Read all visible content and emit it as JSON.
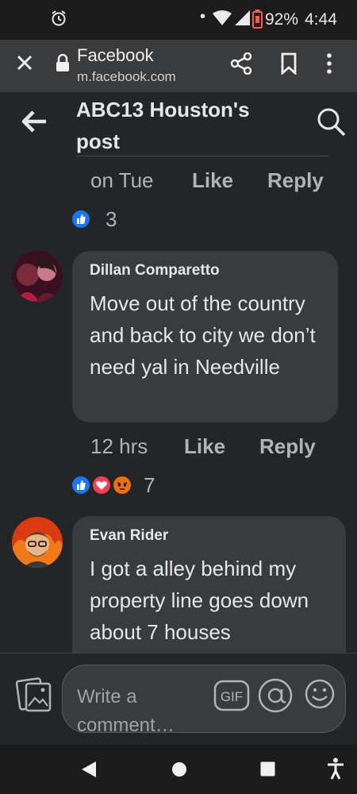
{
  "status_bar": {
    "battery": "92%",
    "time": "4:44"
  },
  "browser": {
    "title": "Facebook",
    "url": "m.facebook.com"
  },
  "header": {
    "title": "ABC13 Houston's post"
  },
  "prev_comment": {
    "time": "on Tue",
    "like_label": "Like",
    "reply_label": "Reply",
    "reaction_count": "3"
  },
  "comments": [
    {
      "author": "Dillan Comparetto",
      "text": "Move out of the country and back to city we don’t need yal in Needville",
      "time": "12 hrs",
      "like_label": "Like",
      "reply_label": "Reply",
      "reaction_count": "7"
    },
    {
      "author": "Evan Rider",
      "text": "I got a alley behind my property line  goes down about 7 houses"
    }
  ],
  "composer": {
    "placeholder": "Write a comment…",
    "gif_label": "GIF"
  },
  "colors": {
    "like_blue": "#1877f2",
    "love_red": "#f33e58",
    "angry_orange": "#e9710f"
  }
}
